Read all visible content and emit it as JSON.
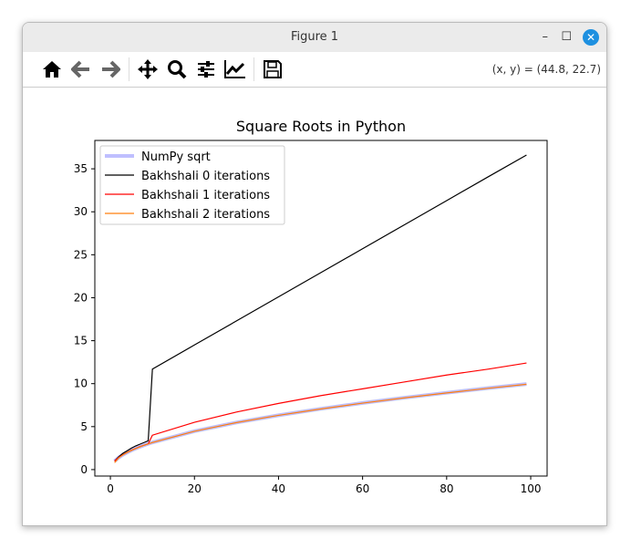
{
  "window": {
    "title": "Figure 1",
    "coord": "(x, y) = (44.8, 22.7)"
  },
  "toolbar": [
    "home-icon",
    "back-icon",
    "forward-icon",
    "pan-icon",
    "zoom-icon",
    "configure-subplots-icon",
    "edit-axis-icon",
    "save-icon"
  ],
  "chart_data": {
    "type": "line",
    "title": "Square Roots in Python",
    "xlabel": "",
    "ylabel": "",
    "xlim": [
      -3.7,
      103.9
    ],
    "ylim": [
      -0.75,
      38.3
    ],
    "xticks": [
      0,
      20,
      40,
      60,
      80,
      100
    ],
    "yticks": [
      0,
      5,
      10,
      15,
      20,
      25,
      30,
      35
    ],
    "legend_position": "top-left",
    "x": [
      1,
      2,
      3,
      4,
      5,
      6,
      7,
      8,
      9,
      10,
      20,
      30,
      40,
      50,
      60,
      70,
      80,
      90,
      99
    ],
    "series": [
      {
        "name": "NumPy sqrt",
        "color": "#bfbfff",
        "width": 4,
        "values": [
          1,
          1.41,
          1.73,
          2,
          2.24,
          2.45,
          2.65,
          2.83,
          3,
          3.16,
          4.47,
          5.48,
          6.32,
          7.07,
          7.75,
          8.37,
          8.94,
          9.49,
          9.95
        ]
      },
      {
        "name": "Bakhshali 0 iterations",
        "color": "#000000",
        "width": 1.2,
        "values": [
          1,
          1.5,
          1.9,
          2.2,
          2.5,
          2.75,
          2.95,
          3.15,
          3.35,
          11.7,
          14.5,
          17.3,
          20.1,
          22.9,
          25.7,
          28.5,
          31.3,
          34.1,
          36.6
        ]
      },
      {
        "name": "Bakhshali 1 iterations",
        "color": "#ff0000",
        "width": 1.2,
        "values": [
          1,
          1.42,
          1.74,
          2,
          2.25,
          2.46,
          2.66,
          2.84,
          3,
          4.0,
          5.5,
          6.7,
          7.7,
          8.6,
          9.4,
          10.2,
          11.0,
          11.7,
          12.4
        ]
      },
      {
        "name": "Bakhshali 2 iterations",
        "color": "#ff7f0e",
        "width": 1.2,
        "values": [
          0.8,
          1.38,
          1.72,
          2,
          2.23,
          2.44,
          2.64,
          2.82,
          2.98,
          3.15,
          4.46,
          5.47,
          6.31,
          7.05,
          7.73,
          8.35,
          8.92,
          9.47,
          9.93
        ]
      }
    ]
  }
}
